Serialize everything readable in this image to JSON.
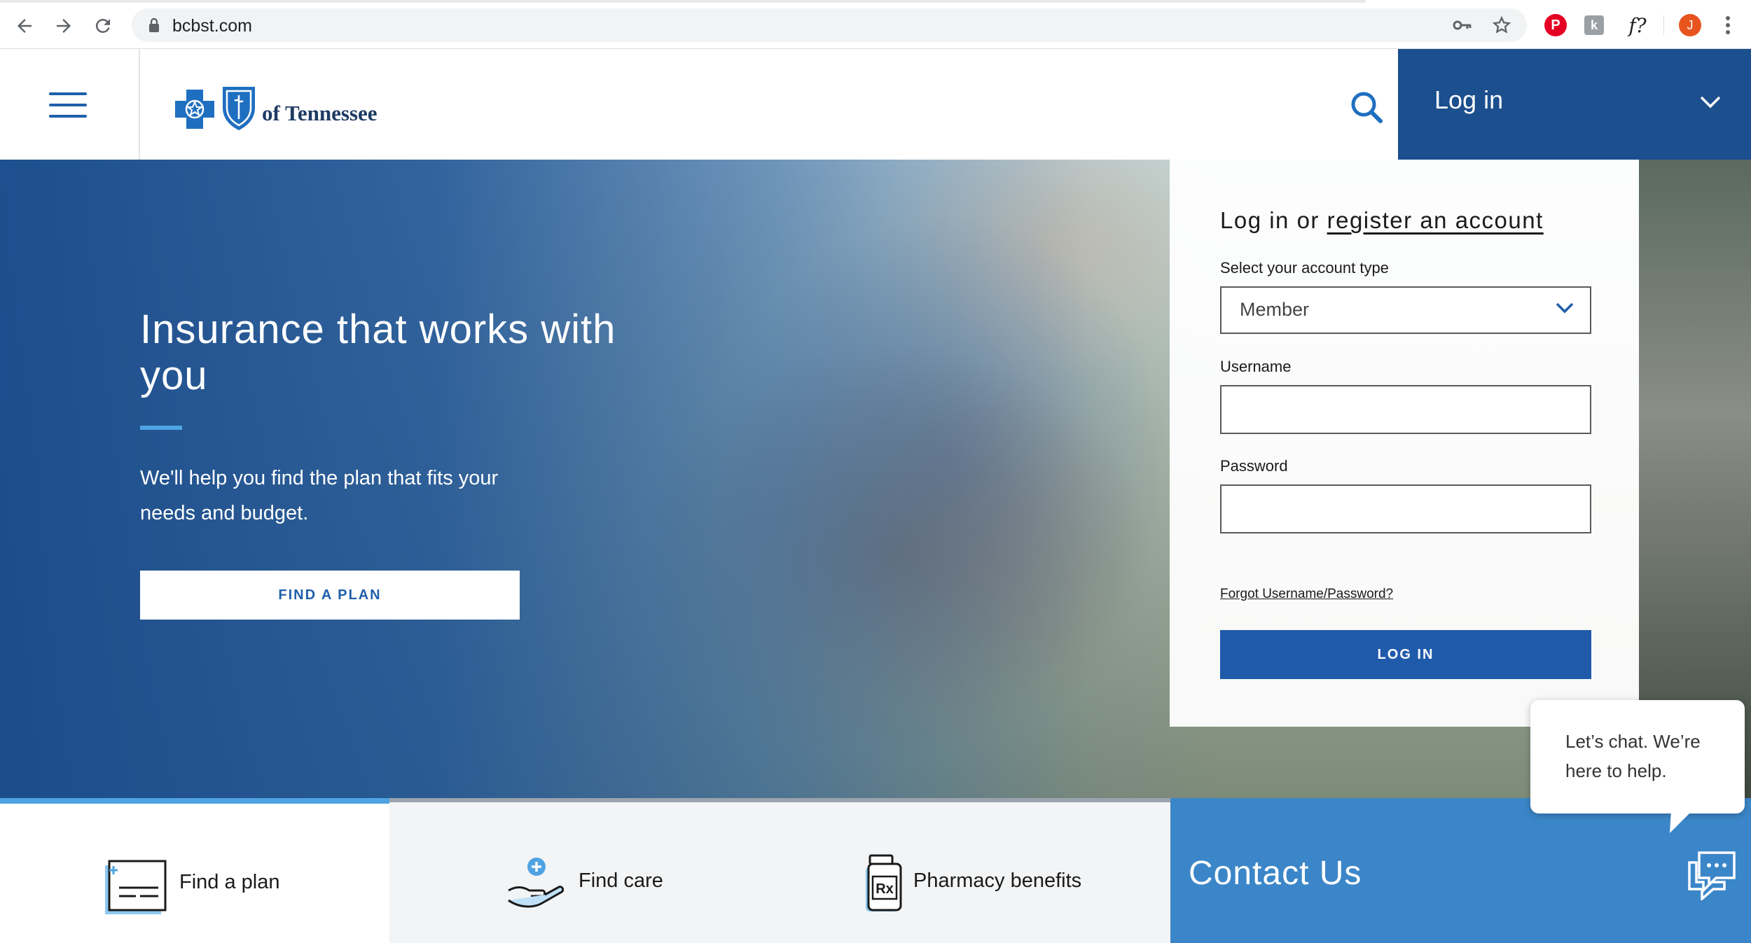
{
  "browser": {
    "url": "bcbst.com",
    "avatar_letter": "J",
    "extension_f_label": "f?",
    "icons": [
      "back-icon",
      "forward-icon",
      "reload-icon",
      "lock-icon",
      "key-icon",
      "star-icon",
      "pinterest-icon",
      "extension-icon",
      "kebab-menu-icon"
    ]
  },
  "header": {
    "logo_text": "of Tennessee",
    "login_toggle_label": "Log in",
    "colors": {
      "brand_dark": "#1b4f8e",
      "brand_blue": "#1f5faa",
      "accent": "#4fa3e3"
    }
  },
  "hero": {
    "title": "Insurance that works with you",
    "subtitle": "We'll help you find the plan that fits your needs and budget.",
    "cta_label": "FIND A PLAN"
  },
  "login": {
    "heading_prefix": "Log in or",
    "register_link": "register an account",
    "account_type_label": "Select your account type",
    "account_type_value": "Member",
    "username_label": "Username",
    "username_value": "",
    "password_label": "Password",
    "password_value": "",
    "forgot_link": "Forgot Username/Password?",
    "submit_label": "LOG IN"
  },
  "bottom_nav": {
    "items": [
      {
        "label": "Find a plan",
        "icon": "plan-document-icon"
      },
      {
        "label": "Find care",
        "icon": "hand-care-icon"
      },
      {
        "label": "Pharmacy benefits",
        "icon": "pill-bottle-icon"
      }
    ],
    "contact_label": "Contact Us"
  },
  "chat": {
    "message": "Let’s chat. We’re here to help.",
    "icon": "chat-icon"
  }
}
